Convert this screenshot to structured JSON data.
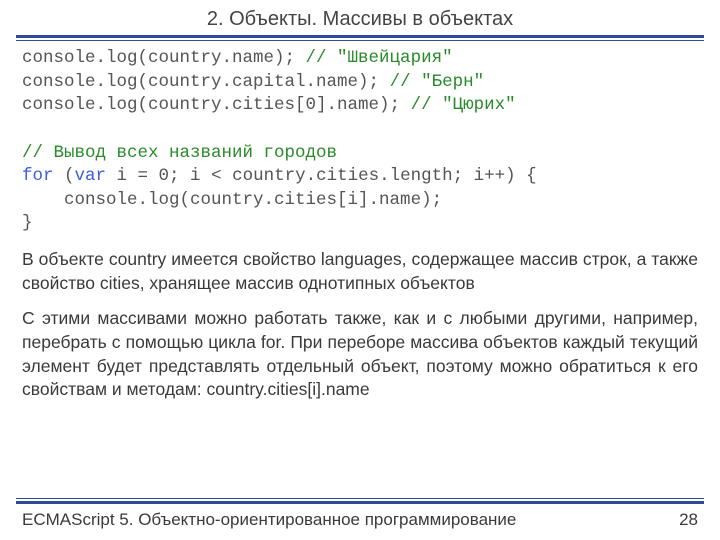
{
  "title": "2. Объекты. Массивы в объектах",
  "code": {
    "l1a": "console.log(country.name); ",
    "l1c": "// \"Швейцария\"",
    "l2a": "console.log(country.capital.name); ",
    "l2c": "// \"Берн\"",
    "l3a": "console.log(country.cities[0].name); ",
    "l3c": "// \"Цюрих\"",
    "l4c": "// Вывод всех названий городов",
    "l5for": "for",
    "l5a": " (",
    "l5var": "var",
    "l5b": " i = 0; i < country.cities.length; i++) {",
    "l6": "    console.log(country.cities[i].name);",
    "l7": "}"
  },
  "para1": "В объекте country имеется свойство languages, содержащее массив строк, а также свойство cities, хранящее массив однотипных объектов",
  "para2": "С этими массивами можно работать также, как и с любыми другими, например, перебрать с помощью цикла for. При переборе массива объектов каждый текущий элемент будет представлять отдельный объект, поэтому можно обратиться к его свойствам и методам: country.cities[i].name",
  "footer": {
    "left": "ECMAScript 5. Объектно-ориентированное программирование",
    "page": "28"
  }
}
